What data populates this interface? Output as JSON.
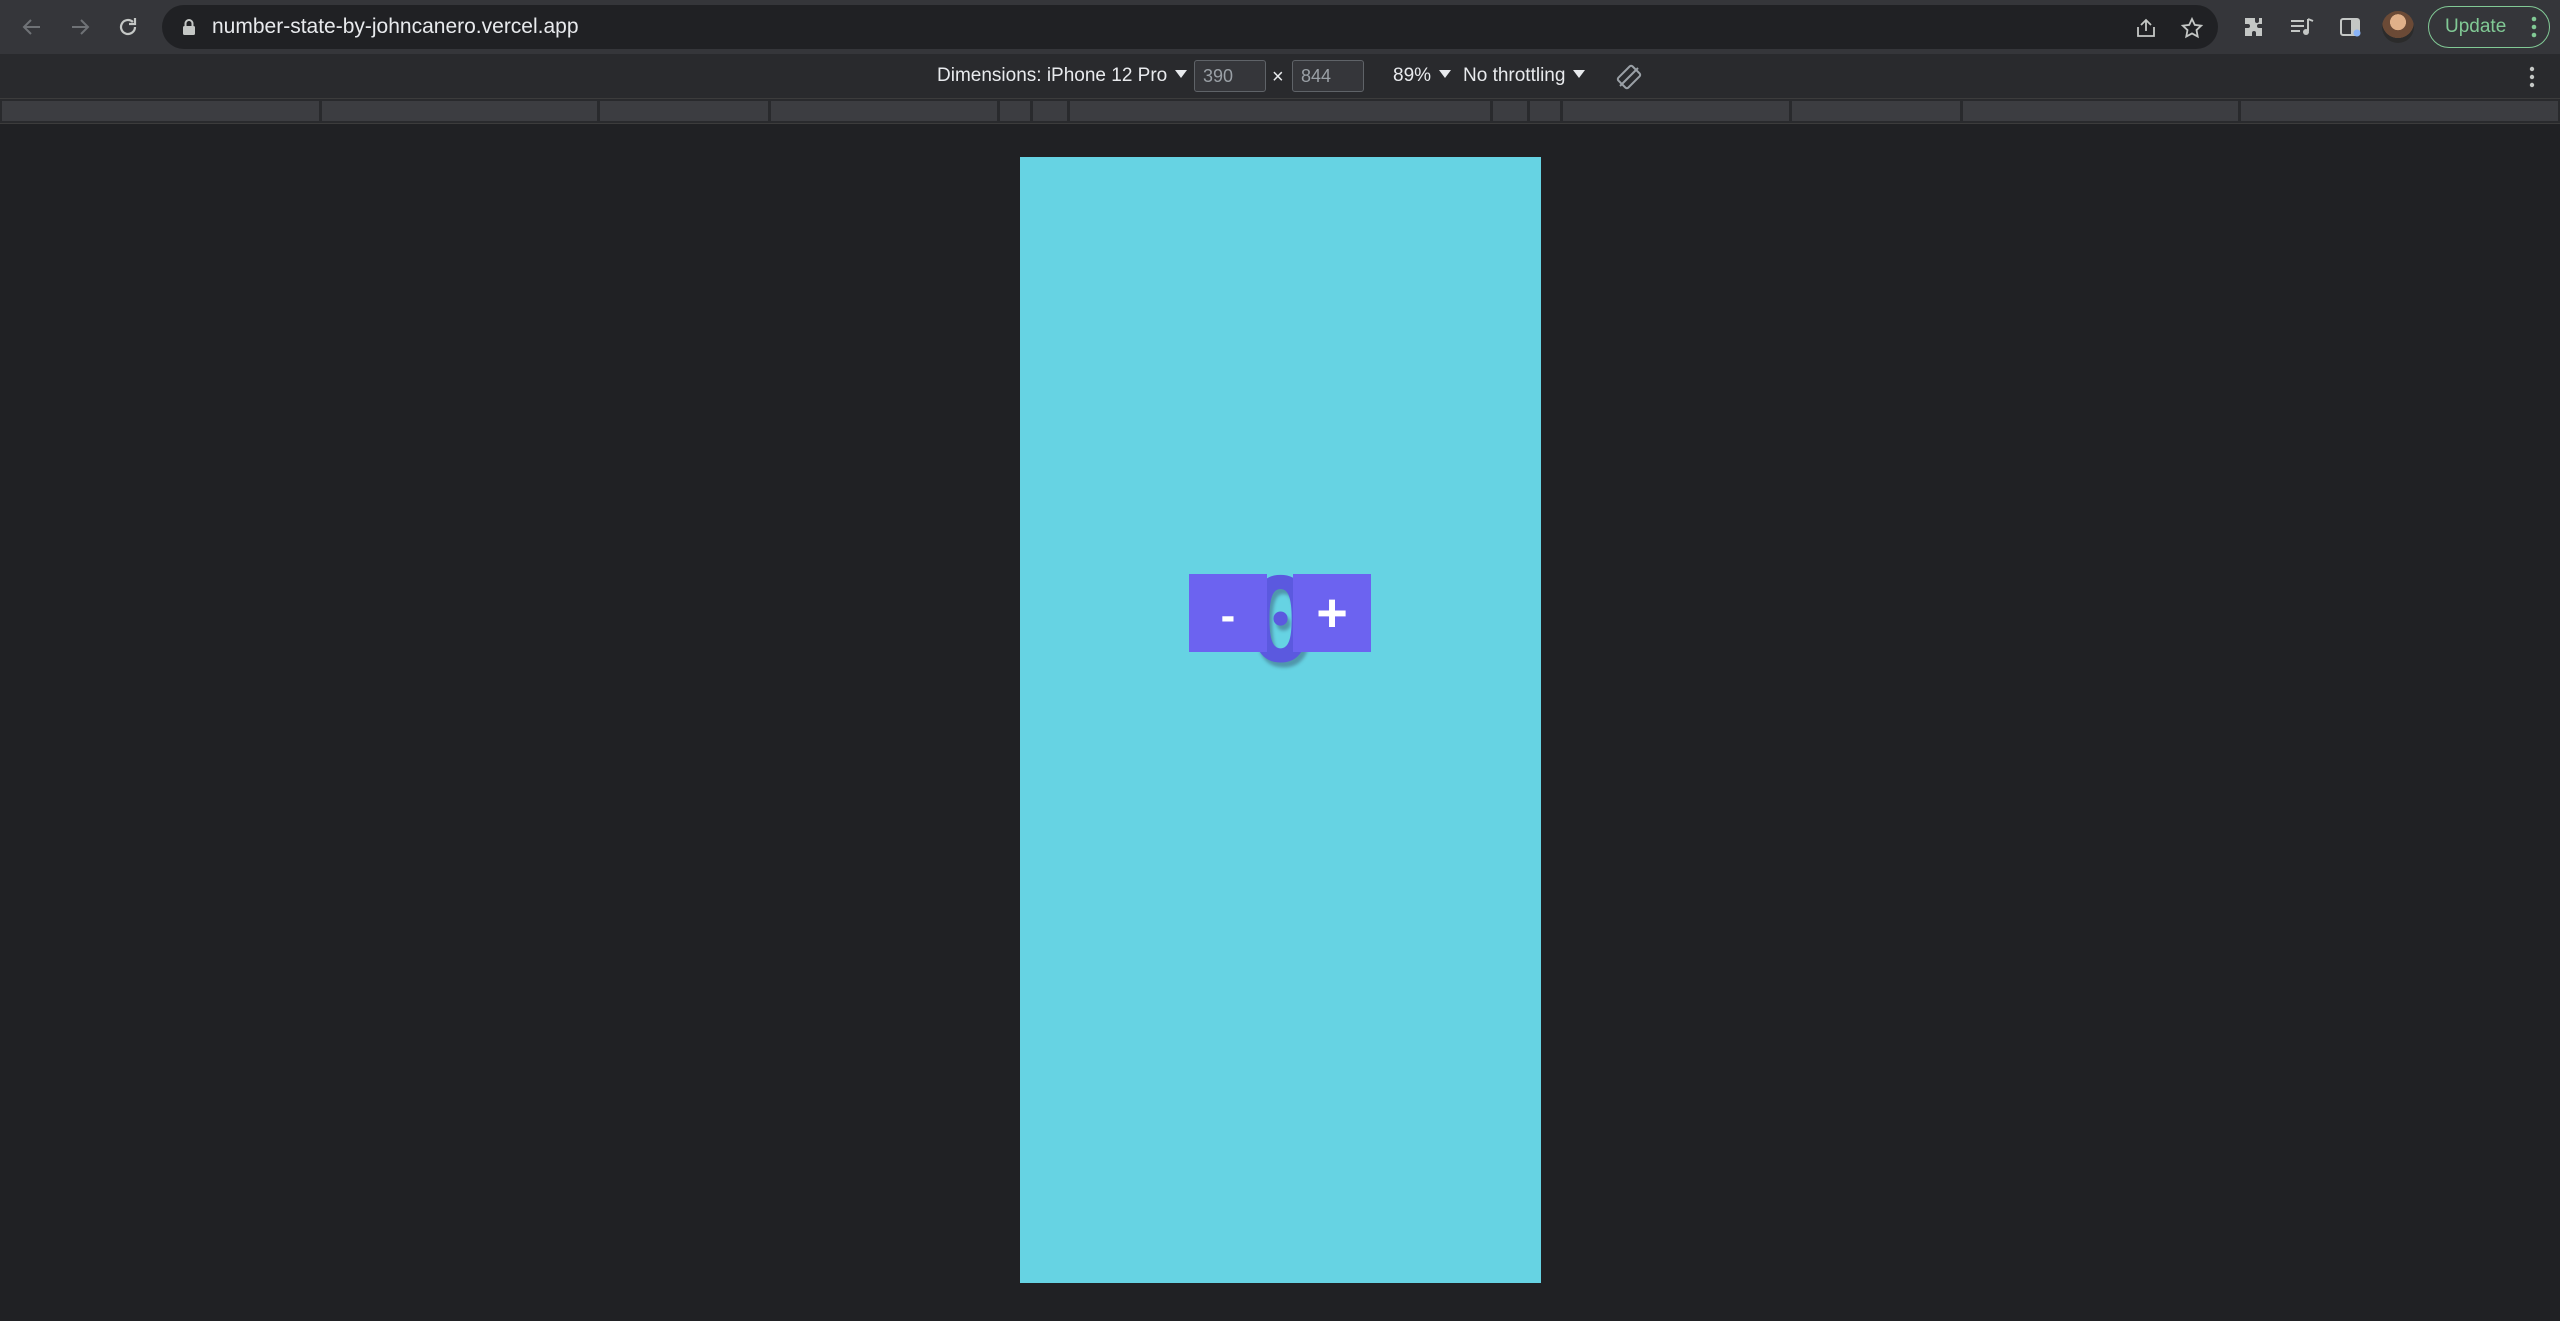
{
  "browser": {
    "url": "number-state-by-johncanero.vercel.app",
    "update_label": "Update"
  },
  "device_toolbar": {
    "dimensions_label": "Dimensions: iPhone 12 Pro",
    "width_value": "390",
    "height_value": "844",
    "times_symbol": "×",
    "zoom_label": "89%",
    "throttling_label": "No throttling"
  },
  "app": {
    "counter_value": "0",
    "decrement_label": "-",
    "increment_label": "+"
  },
  "colors": {
    "viewport_background": "#66d3e3",
    "button_background": "#6c63f0",
    "counter_text": "#5b59df",
    "update_accent": "#81c995"
  },
  "icons": {
    "back": "arrow-left-icon",
    "forward": "arrow-right-icon",
    "reload": "reload-icon",
    "lock": "lock-icon",
    "share": "share-icon",
    "bookmark": "star-icon",
    "extensions": "puzzle-icon",
    "media": "media-queue-icon",
    "side_panel": "side-panel-icon",
    "rotate": "rotate-icon",
    "menu": "kebab-menu-icon"
  }
}
